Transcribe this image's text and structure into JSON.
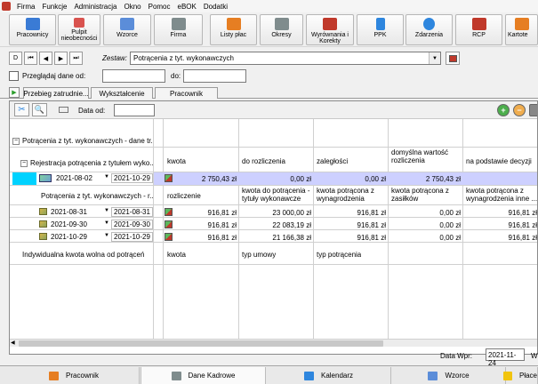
{
  "menu": [
    "Firma",
    "Funkcje",
    "Administracja",
    "Okno",
    "Pomoc",
    "eBOK",
    "Dodatki"
  ],
  "toolbar": [
    {
      "id": "pracownicy",
      "label": "Pracownicy",
      "icon": "people-icon",
      "color": "#3a7bd5"
    },
    {
      "id": "pulpit",
      "label": "Pulpit nieobecności",
      "icon": "calendar-icon",
      "color": "#d9534f"
    },
    {
      "id": "wzorce",
      "label": "Wzorce",
      "icon": "template-icon",
      "color": "#5b8dd9"
    },
    {
      "id": "firma",
      "label": "Firma",
      "icon": "building-icon",
      "color": "#7f8c8d"
    },
    {
      "id": "listy",
      "label": "Listy płac",
      "icon": "payroll-icon",
      "color": "#e67e22"
    },
    {
      "id": "okresy",
      "label": "Okresy",
      "icon": "period-icon",
      "color": "#7f8c8d"
    },
    {
      "id": "wyrownania",
      "label": "Wyrównania i Korekty",
      "icon": "correction-icon",
      "color": "#c0392b"
    },
    {
      "id": "ppk",
      "label": "PPK",
      "icon": "chart-icon",
      "color": "#2e86de"
    },
    {
      "id": "zdarzenia",
      "label": "Zdarzenia",
      "icon": "globe-icon",
      "color": "#2e86de"
    },
    {
      "id": "rcp",
      "label": "RCP",
      "icon": "clock-icon",
      "color": "#c0392b"
    },
    {
      "id": "kartoteki",
      "label": "Kartote",
      "icon": "card-icon",
      "color": "#e67e22"
    }
  ],
  "nav": {
    "buttons": [
      "D",
      "⏮",
      "◀",
      "▶",
      "⏭"
    ],
    "zestaw_label": "Zestaw:",
    "zestaw_value": "Potrącenia z tyt. wykonawczych"
  },
  "dates": {
    "label": "Przeglądaj dane od:",
    "do_label": "do:"
  },
  "tabs": [
    "Przebieg zatrudnie...",
    "Wykształcenie",
    "Pracownik"
  ],
  "panel": {
    "data_od_label": "Data od:",
    "group1": "Potrącenia z tyt. wykonawczych - dane tr...",
    "group2": "Rejestracja potrącenia z tytułem wyko...",
    "header1": [
      "kwota",
      "do rozliczenia",
      "zaległości",
      "domyślna wartość rozliczenia",
      "na podstawie decyzji"
    ],
    "main_row": {
      "date_from": "2021-08-02",
      "date_to": "2021-10-29",
      "values": [
        "2 750,43 zł",
        "0,00 zł",
        "0,00 zł",
        "2 750,43 zł"
      ]
    },
    "subgroup": "Potrącenia z tyt. wykonawczych - r...",
    "header2": [
      "rozliczenie",
      "kwota do potrącenia - tytuły wykonawcze",
      "kwota potrącona z wynagrodzenia",
      "kwota potrącona z zasiłków",
      "kwota potrącona z wynagrodzenia inne ..."
    ],
    "sub_rows": [
      {
        "from": "2021-08-31",
        "to": "2021-08-31",
        "values": [
          "916,81 zł",
          "23 000,00 zł",
          "916,81 zł",
          "0,00 zł",
          "916,81 zł"
        ]
      },
      {
        "from": "2021-09-30",
        "to": "2021-09-30",
        "values": [
          "916,81 zł",
          "22 083,19 zł",
          "916,81 zł",
          "0,00 zł",
          "916,81 zł"
        ]
      },
      {
        "from": "2021-10-29",
        "to": "2021-10-29",
        "values": [
          "916,81 zł",
          "21 166,38 zł",
          "916,81 zł",
          "0,00 zł",
          "916,81 zł"
        ]
      }
    ],
    "group3": "Indywidualna kwota wolna od potrąceń",
    "header3": [
      "kwota",
      "typ umowy",
      "typ potrącenia"
    ]
  },
  "data_wpr": {
    "label": "Data Wpr:",
    "value": "2021-11-24",
    "trunc": "W"
  },
  "bottom_tabs": [
    {
      "label": "Pracownik",
      "color": "#e67e22",
      "active": false
    },
    {
      "label": "Dane Kadrowe",
      "color": "#7f8c8d",
      "active": true
    },
    {
      "label": "Kalendarz",
      "color": "#2e86de",
      "active": false
    },
    {
      "label": "Wzorce",
      "color": "#5b8dd9",
      "active": false
    },
    {
      "label": "Płace",
      "color": "#f1c40f",
      "active": false
    }
  ]
}
